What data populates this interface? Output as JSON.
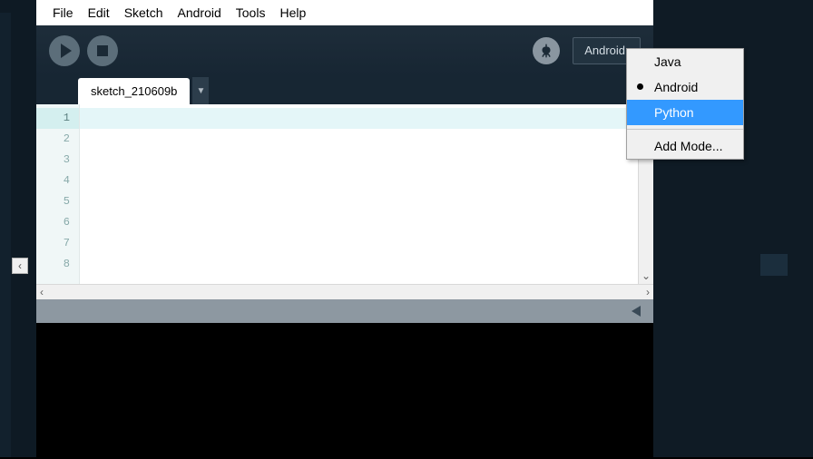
{
  "menubar": {
    "items": [
      "File",
      "Edit",
      "Sketch",
      "Android",
      "Tools",
      "Help"
    ]
  },
  "toolbar": {
    "mode_label": "Android"
  },
  "tabs": {
    "active": "sketch_210609b",
    "dropdown_glyph": "▼"
  },
  "gutter": {
    "lines": [
      1,
      2,
      3,
      4,
      5,
      6,
      7,
      8
    ],
    "highlighted": 1
  },
  "mode_menu": {
    "items": [
      {
        "label": "Java",
        "selected": false,
        "highlighted": false
      },
      {
        "label": "Android",
        "selected": true,
        "highlighted": false
      },
      {
        "label": "Python",
        "selected": false,
        "highlighted": true
      }
    ],
    "footer": "Add Mode..."
  }
}
